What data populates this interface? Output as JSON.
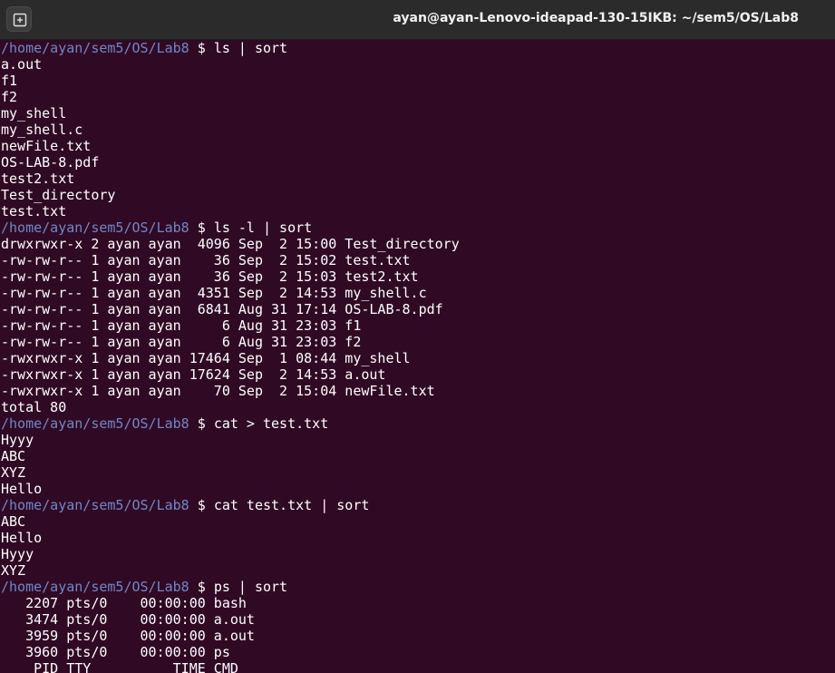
{
  "window": {
    "title": "ayan@ayan-Lenovo-ideapad-130-15IKB: ~/sem5/OS/Lab8"
  },
  "colors": {
    "background": "#300a24",
    "prompt_path": "#7187c6",
    "text": "#ffffff",
    "titlebar": "#2b2b2b"
  },
  "terminal": {
    "prompt_path": "/home/ayan/sem5/OS/Lab8",
    "prompt_symbol": " $ ",
    "lines": [
      {
        "type": "prompt",
        "cmd": "ls | sort"
      },
      {
        "type": "out",
        "text": "a.out"
      },
      {
        "type": "out",
        "text": "f1"
      },
      {
        "type": "out",
        "text": "f2"
      },
      {
        "type": "out",
        "text": "my_shell"
      },
      {
        "type": "out",
        "text": "my_shell.c"
      },
      {
        "type": "out",
        "text": "newFile.txt"
      },
      {
        "type": "out",
        "text": "OS-LAB-8.pdf"
      },
      {
        "type": "out",
        "text": "test2.txt"
      },
      {
        "type": "out",
        "text": "Test_directory"
      },
      {
        "type": "out",
        "text": "test.txt"
      },
      {
        "type": "prompt",
        "cmd": "ls -l | sort"
      },
      {
        "type": "out",
        "text": "drwxrwxr-x 2 ayan ayan  4096 Sep  2 15:00 Test_directory"
      },
      {
        "type": "out",
        "text": "-rw-rw-r-- 1 ayan ayan    36 Sep  2 15:02 test.txt"
      },
      {
        "type": "out",
        "text": "-rw-rw-r-- 1 ayan ayan    36 Sep  2 15:03 test2.txt"
      },
      {
        "type": "out",
        "text": "-rw-rw-r-- 1 ayan ayan  4351 Sep  2 14:53 my_shell.c"
      },
      {
        "type": "out",
        "text": "-rw-rw-r-- 1 ayan ayan  6841 Aug 31 17:14 OS-LAB-8.pdf"
      },
      {
        "type": "out",
        "text": "-rw-rw-r-- 1 ayan ayan     6 Aug 31 23:03 f1"
      },
      {
        "type": "out",
        "text": "-rw-rw-r-- 1 ayan ayan     6 Aug 31 23:03 f2"
      },
      {
        "type": "out",
        "text": "-rwxrwxr-x 1 ayan ayan 17464 Sep  1 08:44 my_shell"
      },
      {
        "type": "out",
        "text": "-rwxrwxr-x 1 ayan ayan 17624 Sep  2 14:53 a.out"
      },
      {
        "type": "out",
        "text": "-rwxrwxr-x 1 ayan ayan    70 Sep  2 15:04 newFile.txt"
      },
      {
        "type": "out",
        "text": "total 80"
      },
      {
        "type": "prompt",
        "cmd": "cat > test.txt"
      },
      {
        "type": "out",
        "text": "Hyyy"
      },
      {
        "type": "out",
        "text": "ABC"
      },
      {
        "type": "out",
        "text": "XYZ"
      },
      {
        "type": "out",
        "text": "Hello"
      },
      {
        "type": "prompt",
        "cmd": "cat test.txt | sort"
      },
      {
        "type": "out",
        "text": "ABC"
      },
      {
        "type": "out",
        "text": "Hello"
      },
      {
        "type": "out",
        "text": "Hyyy"
      },
      {
        "type": "out",
        "text": "XYZ"
      },
      {
        "type": "prompt",
        "cmd": "ps | sort"
      },
      {
        "type": "out",
        "text": "   2207 pts/0    00:00:00 bash"
      },
      {
        "type": "out",
        "text": "   3474 pts/0    00:00:00 a.out"
      },
      {
        "type": "out",
        "text": "   3959 pts/0    00:00:00 a.out"
      },
      {
        "type": "out",
        "text": "   3960 pts/0    00:00:00 ps"
      },
      {
        "type": "out",
        "text": "    PID TTY          TIME CMD"
      }
    ]
  }
}
